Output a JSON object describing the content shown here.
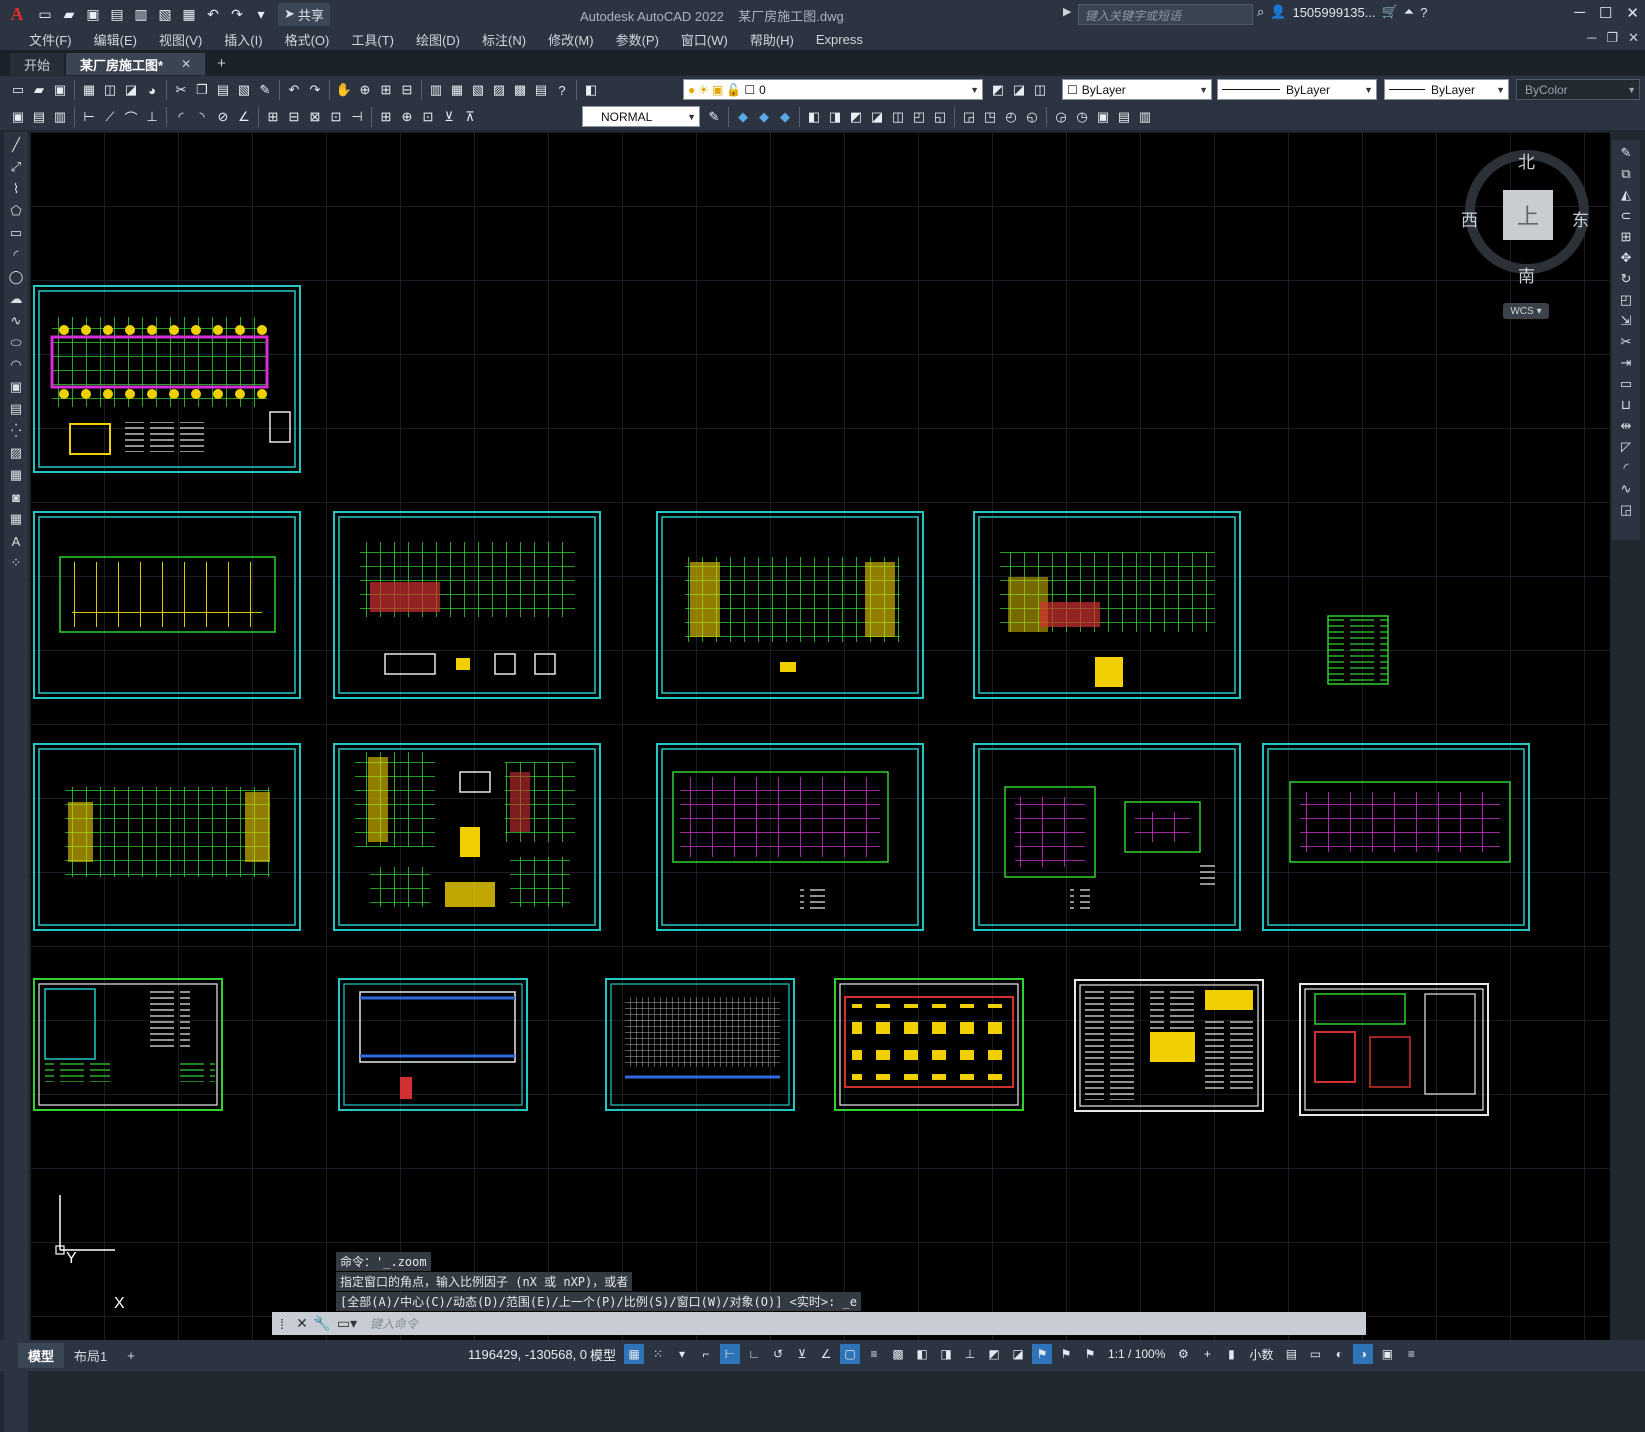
{
  "titlebar": {
    "app_title": "Autodesk AutoCAD 2022    某厂房施工图.dwg",
    "share_label": "共享",
    "search_placeholder": "键入关键字或短语",
    "user": "1505999135...",
    "logo": "A"
  },
  "menu": [
    "文件(F)",
    "编辑(E)",
    "视图(V)",
    "插入(I)",
    "格式(O)",
    "工具(T)",
    "绘图(D)",
    "标注(N)",
    "修改(M)",
    "参数(P)",
    "窗口(W)",
    "帮助(H)",
    "Express"
  ],
  "tabs": {
    "start": "开始",
    "drawing": "某厂房施工图*"
  },
  "toolbar": {
    "layer_value": "0",
    "color_value": "ByLayer",
    "linetype_value": "ByLayer",
    "lineweight_value": "ByLayer",
    "plotstyle_value": "ByColor",
    "style_value": "NORMAL"
  },
  "viewcube": {
    "top": "上",
    "north": "北",
    "south": "南",
    "east": "东",
    "west": "西",
    "wcs": "WCS"
  },
  "ucs": {
    "x": "X",
    "y": "Y"
  },
  "command": {
    "history": [
      "命令：'_.zoom",
      "指定窗口的角点，输入比例因子 (nX 或 nXP)，或者",
      "[全部(A)/中心(C)/动态(D)/范围(E)/上一个(P)/比例(S)/窗口(W)/对象(O)] <实时>: _e"
    ],
    "placeholder": "键入命令"
  },
  "status": {
    "model_tab": "模型",
    "layout_tab": "布局1",
    "coords": "1196429, -130568, 0",
    "model_label": "模型",
    "scale": "1:1 / 100%",
    "units": "小数"
  }
}
